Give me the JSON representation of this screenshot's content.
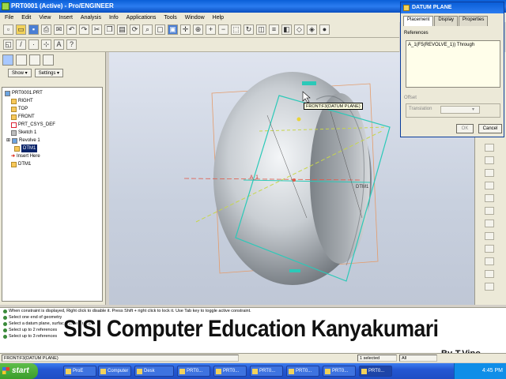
{
  "window": {
    "title": "PRT0001 (Active) - Pro/ENGINEER"
  },
  "menu": [
    "File",
    "Edit",
    "View",
    "Insert",
    "Analysis",
    "Info",
    "Applications",
    "Tools",
    "Window",
    "Help"
  ],
  "model_tree": {
    "show_label": "Show",
    "settings_label": "Settings",
    "items": [
      {
        "label": "PRT0001.PRT",
        "icon": "part-icon"
      },
      {
        "label": "RIGHT",
        "icon": "datum-plane-icon"
      },
      {
        "label": "TOP",
        "icon": "datum-plane-icon"
      },
      {
        "label": "FRONT",
        "icon": "datum-plane-icon"
      },
      {
        "label": "PRT_CSYS_DEF",
        "icon": "csys-icon"
      },
      {
        "label": "Sketch 1",
        "icon": "sketch-icon"
      },
      {
        "label": "Revolve 1",
        "icon": "revolve-icon"
      },
      {
        "label": "DTM1",
        "icon": "datum-plane-icon",
        "selected": true
      },
      {
        "label": "Insert Here",
        "icon": "insert-here-icon"
      },
      {
        "label": "DTM1",
        "icon": "datum-plane-icon"
      }
    ]
  },
  "viewport": {
    "tooltip": "FRONT:F3(DATUM PLANE)",
    "label_a1": "A_1",
    "label_dtm": "DTM1"
  },
  "dialog": {
    "title": "DATUM PLANE",
    "tabs": [
      "Placement",
      "Display",
      "Properties"
    ],
    "references_label": "References",
    "reference_item": "A_1(F5(REVOLVE_1))   Through",
    "offset_label": "Offset",
    "translation_label": "Translation",
    "ok_label": "OK",
    "cancel_label": "Cancel"
  },
  "messages": [
    "When constraint is displayed, Right click to disable it. Press Shift + right click to lock it. Use Tab key to toggle active constraint.",
    "Select one end of geometry",
    "Select a datum plane, surface, edge or axis",
    "Select up to 2 references",
    "Select up to 3 references"
  ],
  "watermark": "SISI Computer Education Kanyakumari",
  "author": "By-T.Vino",
  "status": {
    "left": "FRONT:F3(DATUM PLANE)",
    "selected": "1 selected",
    "filter": "All"
  },
  "taskbar": {
    "start": "start",
    "tasks": [
      "ProE",
      "Computer",
      "Desk",
      "PRT0...",
      "PRT0...",
      "PRT0...",
      "PRT0...",
      "PRT0...",
      "PRT0..."
    ],
    "clock": "4:45 PM"
  }
}
